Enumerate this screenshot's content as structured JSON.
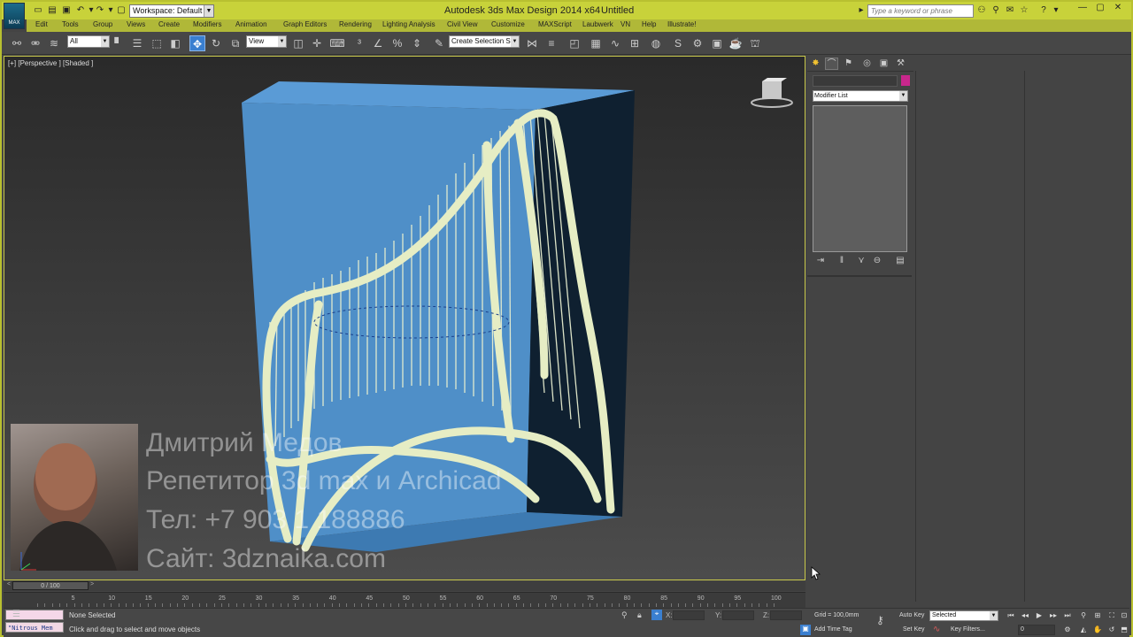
{
  "app": {
    "title": "Autodesk 3ds Max Design 2014 x64",
    "file": "Untitled",
    "logo_label": "MAX",
    "workspace": "Workspace: Default",
    "search_placeholder": "Type a keyword or phrase"
  },
  "menu": [
    "Edit",
    "Tools",
    "Group",
    "Views",
    "Create",
    "Modifiers",
    "Animation",
    "Graph Editors",
    "Rendering",
    "Lighting Analysis",
    "Civil View",
    "Customize",
    "MAXScript",
    "Laubwerk",
    "VN",
    "Help",
    "Illustrate!"
  ],
  "toolbar": {
    "filter": "All",
    "ref_coord": "View",
    "selection_set": "Create Selection Se"
  },
  "viewport": {
    "label": "[+] [Perspective ] [Shaded ]",
    "watermark": {
      "name": "Дмитрий Медов",
      "role": "Репетитор 3d max и Archicad",
      "phone": "Тел: +7 903 1 188886",
      "site": "Сайт: 3dznaika.com"
    }
  },
  "command_panel": {
    "modifier_list": "Modifier List"
  },
  "timeline": {
    "frame_label": "0 / 100",
    "prev": "<",
    "next": ">",
    "ticks": [
      0,
      5,
      10,
      15,
      20,
      25,
      30,
      35,
      40,
      45,
      50,
      55,
      60,
      65,
      70,
      75,
      80,
      85,
      90,
      95,
      100
    ]
  },
  "status": {
    "maxscript": "\"Nitrous Mem",
    "selection": "None Selected",
    "prompt": "Click and drag to select and move objects",
    "x_label": "X:",
    "y_label": "Y:",
    "z_label": "Z:",
    "grid": "Grid = 100,0mm",
    "add_time_tag": "Add Time Tag",
    "auto_key": "Auto Key",
    "set_key": "Set Key",
    "selected": "Selected",
    "key_filters": "Key Filters...",
    "frame_value": "0"
  },
  "colors": {
    "title_bar": "#c8d23a",
    "box_front": "#4f8fc8",
    "chair_frame": "#e6edc4",
    "active_tool": "#3a7fd0",
    "object_color": "#c8278c"
  }
}
